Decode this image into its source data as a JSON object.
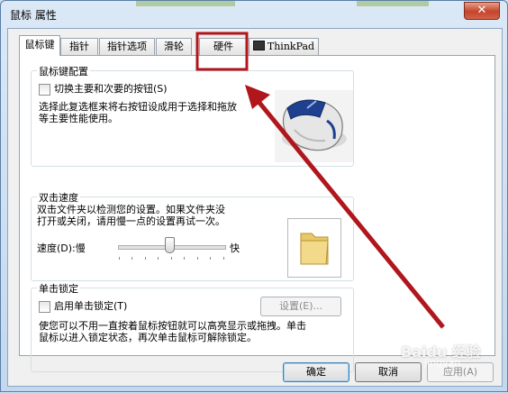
{
  "window": {
    "title": "鼠标 属性",
    "close_glyph": "✕"
  },
  "tabs": [
    {
      "label": "鼠标键"
    },
    {
      "label": "指针"
    },
    {
      "label": "指针选项"
    },
    {
      "label": "滑轮"
    },
    {
      "label": "硬件"
    },
    {
      "label": "ThinkPad"
    }
  ],
  "button_config": {
    "group_label": "鼠标键配置",
    "switch_label": "切换主要和次要的按钮(S)",
    "desc_line1": "选择此复选框来将右按钮设成用于选择和拖放",
    "desc_line2": "等主要性能使用。"
  },
  "double_click": {
    "group_label": "双击速度",
    "desc_line1": "双击文件夹以检测您的设置。如果文件夹没",
    "desc_line2": "打开或关闭，请用慢一点的设置再试一次。",
    "speed_label": "速度(D):慢",
    "fast_label": "快",
    "speed_level": 0.48
  },
  "click_lock": {
    "group_label": "单击锁定",
    "enable_label": "启用单击锁定(T)",
    "settings_button": "设置(E)...",
    "desc_line1": "使您可以不用一直按着鼠标按钮就可以高亮显示或拖拽。单击",
    "desc_line2": "鼠标以进入锁定状态，再次单击鼠标可解除锁定。"
  },
  "footer": {
    "ok": "确定",
    "cancel": "取消",
    "apply": "应用(A)"
  },
  "watermark": {
    "brand": "Baidu 经验",
    "sub": "jingyan"
  },
  "colors": {
    "annotation_red": "#b0161c",
    "folder_yellow": "#e8c86a"
  }
}
